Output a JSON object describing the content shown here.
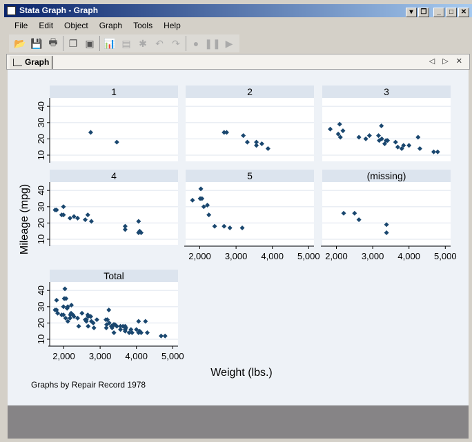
{
  "window": {
    "title": "Stata Graph - Graph",
    "buttons": [
      "▾",
      "❐",
      "_",
      "□",
      "✕"
    ]
  },
  "menu": [
    "File",
    "Edit",
    "Object",
    "Graph",
    "Tools",
    "Help"
  ],
  "toolbar": [
    {
      "icon": "open-icon",
      "g": "📂"
    },
    {
      "icon": "save-icon",
      "g": "💾"
    },
    {
      "icon": "print-icon",
      "g": "🖶"
    },
    {
      "icon": "copy-icon",
      "g": "❐"
    },
    {
      "icon": "export-icon",
      "g": "▣"
    },
    {
      "icon": "graph-editor-icon",
      "g": "📊"
    },
    {
      "icon": "properties-icon",
      "g": "▤",
      "dis": true
    },
    {
      "icon": "pointer-icon",
      "g": "✱",
      "dis": true
    },
    {
      "icon": "undo-icon",
      "g": "↶",
      "dis": true
    },
    {
      "icon": "redo-icon",
      "g": "↷",
      "dis": true
    },
    {
      "icon": "record-icon",
      "g": "●",
      "dis": true
    },
    {
      "icon": "pause-icon",
      "g": "❚❚",
      "dis": true
    },
    {
      "icon": "play-icon",
      "g": "▶",
      "dis": true
    }
  ],
  "tab": {
    "label": "Graph",
    "controls": "◁ ▷ ✕"
  },
  "colors": {
    "marker": "#1a476f",
    "strip": "#dce4ee",
    "plot_bg": "#ffffff",
    "graph_bg": "#eef2f7",
    "grid": "#eaeef4"
  },
  "chart_data": {
    "type": "scatter",
    "xlabel": "Weight (lbs.)",
    "ylabel": "Mileage (mpg)",
    "note": "Graphs by Repair Record 1978",
    "xlim": [
      1760,
      5000
    ],
    "ylim": [
      10,
      40
    ],
    "xticks": [
      2000,
      3000,
      4000,
      5000
    ],
    "xtick_labels": [
      "2,000",
      "3,000",
      "4,000",
      "5,000"
    ],
    "yticks": [
      10,
      20,
      30,
      40
    ],
    "ytick_labels": [
      "10",
      "20",
      "30",
      "40"
    ],
    "grid": true,
    "panels": [
      {
        "title": "1",
        "points": [
          [
            2740,
            24
          ],
          [
            3460,
            18
          ]
        ]
      },
      {
        "title": "2",
        "points": [
          [
            2670,
            24
          ],
          [
            2740,
            24
          ],
          [
            3200,
            22
          ],
          [
            3310,
            18
          ],
          [
            3560,
            18
          ],
          [
            3560,
            16
          ],
          [
            3710,
            17
          ],
          [
            3880,
            14
          ]
        ]
      },
      {
        "title": "3",
        "points": [
          [
            1830,
            26
          ],
          [
            2090,
            29
          ],
          [
            2050,
            23
          ],
          [
            2110,
            21
          ],
          [
            2180,
            25
          ],
          [
            2620,
            21
          ],
          [
            2810,
            20
          ],
          [
            2910,
            22
          ],
          [
            3160,
            22
          ],
          [
            3240,
            28
          ],
          [
            3180,
            19
          ],
          [
            3250,
            20
          ],
          [
            3330,
            17
          ],
          [
            3370,
            19
          ],
          [
            3410,
            19
          ],
          [
            3630,
            18
          ],
          [
            3690,
            15
          ],
          [
            3800,
            14
          ],
          [
            3850,
            16
          ],
          [
            4000,
            16
          ],
          [
            4250,
            21
          ],
          [
            4300,
            14
          ],
          [
            4680,
            12
          ],
          [
            4790,
            12
          ]
        ]
      },
      {
        "title": "4",
        "points": [
          [
            1760,
            28
          ],
          [
            1800,
            28
          ],
          [
            1940,
            25
          ],
          [
            1990,
            25
          ],
          [
            1990,
            30
          ],
          [
            2170,
            23
          ],
          [
            2280,
            24
          ],
          [
            2380,
            23
          ],
          [
            2590,
            22
          ],
          [
            2660,
            25
          ],
          [
            2760,
            21
          ],
          [
            3690,
            18
          ],
          [
            3690,
            16
          ],
          [
            4060,
            21
          ],
          [
            4060,
            14
          ],
          [
            4090,
            15
          ],
          [
            4130,
            14
          ]
        ]
      },
      {
        "title": "5",
        "points": [
          [
            1800,
            34
          ],
          [
            2030,
            41
          ],
          [
            2010,
            35
          ],
          [
            2060,
            35
          ],
          [
            2110,
            30
          ],
          [
            2210,
            31
          ],
          [
            2250,
            25
          ],
          [
            2410,
            18
          ],
          [
            2670,
            18
          ],
          [
            2830,
            17
          ],
          [
            3170,
            17
          ]
        ]
      },
      {
        "title": "(missing)",
        "points": [
          [
            2200,
            26
          ],
          [
            2500,
            26
          ],
          [
            2620,
            22
          ],
          [
            3380,
            19
          ],
          [
            3380,
            14
          ]
        ]
      },
      {
        "title": "Total",
        "points": "all"
      }
    ]
  }
}
